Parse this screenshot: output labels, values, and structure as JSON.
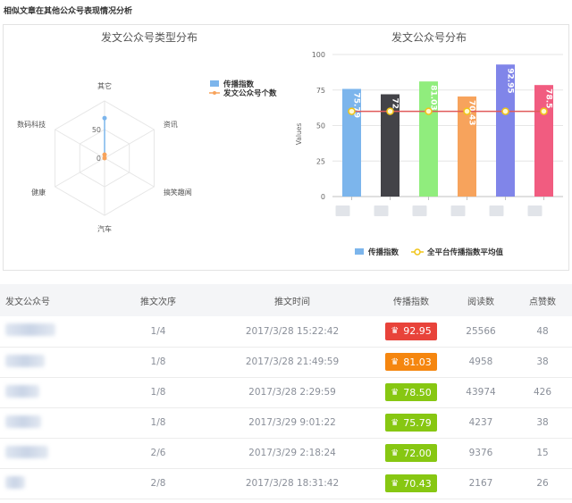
{
  "page": {
    "title": "相似文章在其他公众号表现情况分析"
  },
  "radar": {
    "title": "发文公众号类型分布",
    "axes": [
      "其它",
      "资讯",
      "搞笑趣闻",
      "汽车",
      "健康",
      "数码科技"
    ],
    "ticks": [
      "0",
      "50"
    ],
    "legend": [
      "传播指数",
      "发文公众号个数"
    ],
    "series_colors": [
      "#7cb5ec",
      "#f7a35c"
    ]
  },
  "bar": {
    "title": "发文公众号分布",
    "y_axis_label": "Values",
    "legend": [
      "传播指数",
      "全平台传播指数平均值"
    ],
    "colors": [
      "#7cb5ec",
      "#434348",
      "#90ed7d",
      "#f7a35c",
      "#8085e9",
      "#f15c80"
    ],
    "line_color": "#e05a5a"
  },
  "chart_data": [
    {
      "type": "radar",
      "title": "发文公众号类型分布",
      "categories": [
        "其它",
        "资讯",
        "搞笑趣闻",
        "汽车",
        "健康",
        "数码科技"
      ],
      "series": [
        {
          "name": "传播指数",
          "values": [
            70,
            0,
            0,
            0,
            0,
            0
          ]
        },
        {
          "name": "发文公众号个数",
          "values": [
            6,
            0,
            0,
            0,
            0,
            0
          ]
        }
      ],
      "rlim": [
        0,
        100
      ],
      "ticks": [
        0,
        50
      ]
    },
    {
      "type": "bar",
      "title": "发文公众号分布",
      "ylabel": "Values",
      "ylim": [
        0,
        100
      ],
      "yticks": [
        0,
        25,
        50,
        75,
        100
      ],
      "values": [
        75.79,
        72,
        81.03,
        70.43,
        92.95,
        78.5
      ],
      "value_labels": [
        "75.79",
        "72",
        "81.03",
        "70.43",
        "92.95",
        "78.5"
      ],
      "average_line": {
        "name": "全平台传播指数平均值",
        "value": 60
      },
      "grid": true,
      "legend_position": "bottom"
    }
  ],
  "table": {
    "columns": [
      "发文公众号",
      "推文次序",
      "推文时间",
      "传播指数",
      "阅读数",
      "点赞数"
    ],
    "rows": [
      {
        "order": "1/4",
        "time": "2017/3/28 15:22:42",
        "score": "92.95",
        "score_color": "#e8433a",
        "reads": "25566",
        "likes": "48"
      },
      {
        "order": "1/8",
        "time": "2017/3/28 21:49:59",
        "score": "81.03",
        "score_color": "#f5860f",
        "reads": "4958",
        "likes": "38"
      },
      {
        "order": "1/8",
        "time": "2017/3/28 2:29:59",
        "score": "78.50",
        "score_color": "#87c712",
        "reads": "43974",
        "likes": "426"
      },
      {
        "order": "1/8",
        "time": "2017/3/29 9:01:22",
        "score": "75.79",
        "score_color": "#87c712",
        "reads": "4237",
        "likes": "38"
      },
      {
        "order": "2/6",
        "time": "2017/3/29 2:18:24",
        "score": "72.00",
        "score_color": "#87c712",
        "reads": "9376",
        "likes": "15"
      },
      {
        "order": "2/8",
        "time": "2017/3/28 18:31:42",
        "score": "70.43",
        "score_color": "#87c712",
        "reads": "2167",
        "likes": "26"
      }
    ]
  }
}
